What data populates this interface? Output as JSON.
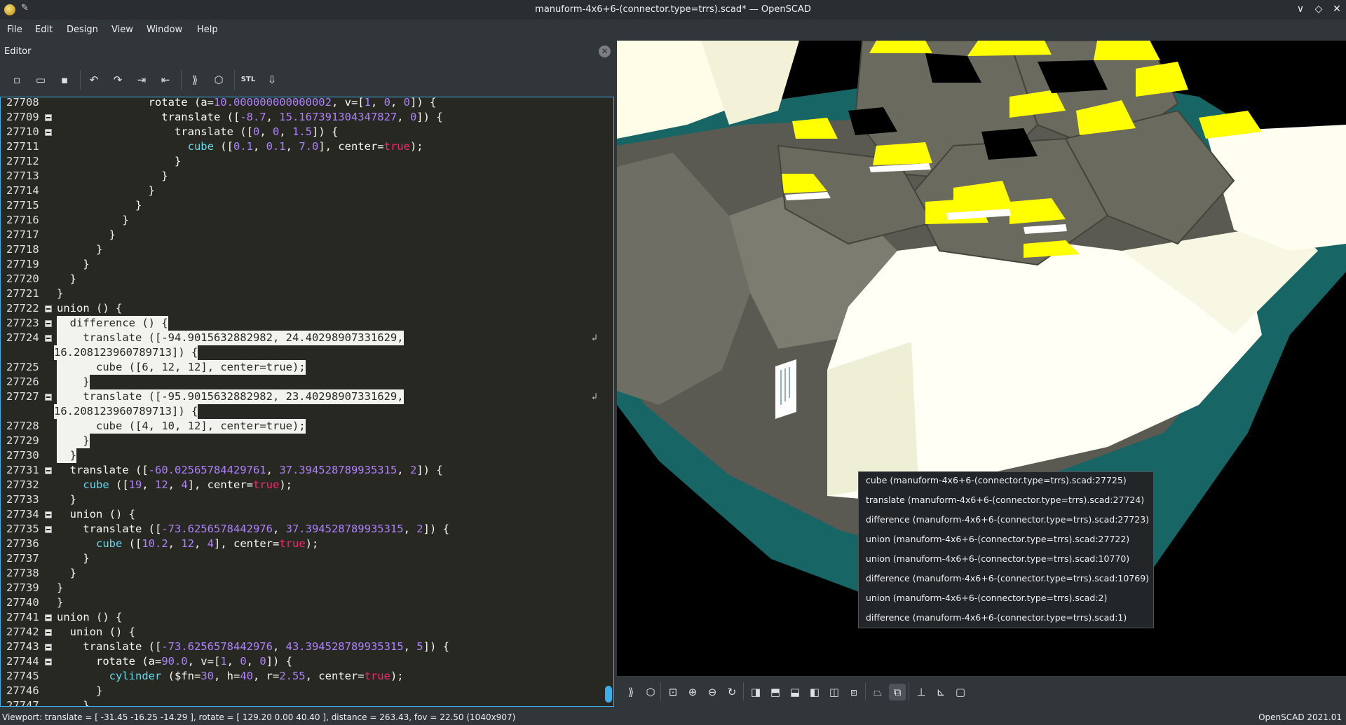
{
  "window": {
    "title": "manuform-4x6+6-(connector.type=trrs).scad* — OpenSCAD",
    "controls": [
      "∨",
      "◇",
      "✕"
    ]
  },
  "menu": [
    "File",
    "Edit",
    "Design",
    "View",
    "Window",
    "Help"
  ],
  "editor": {
    "title": "Editor",
    "close_label": "✕",
    "toolbar": [
      "new-icon",
      "open-icon",
      "save-icon",
      "undo-icon",
      "redo-icon",
      "indent-icon",
      "unindent-icon",
      "preview-icon",
      "render-icon",
      "export-stl-icon",
      "send-to-print-icon"
    ],
    "lines": [
      {
        "num": "27708",
        "fold": false,
        "text": "              rotate (a=10.000000000000002, v=[1, 0, 0]) {"
      },
      {
        "num": "27709",
        "fold": true,
        "text": "                translate ([-8.7, 15.167391304347827, 0]) {"
      },
      {
        "num": "27710",
        "fold": true,
        "text": "                  translate ([0, 0, 1.5]) {"
      },
      {
        "num": "27711",
        "fold": false,
        "text": "                    cube ([0.1, 0.1, 7.0], center=true);"
      },
      {
        "num": "27712",
        "fold": false,
        "text": "                  }"
      },
      {
        "num": "27713",
        "fold": false,
        "text": "                }"
      },
      {
        "num": "27714",
        "fold": false,
        "text": "              }"
      },
      {
        "num": "27715",
        "fold": false,
        "text": "            }"
      },
      {
        "num": "27716",
        "fold": false,
        "text": "          }"
      },
      {
        "num": "27717",
        "fold": false,
        "text": "        }"
      },
      {
        "num": "27718",
        "fold": false,
        "text": "      }"
      },
      {
        "num": "27719",
        "fold": false,
        "text": "    }"
      },
      {
        "num": "27720",
        "fold": false,
        "text": "  }"
      },
      {
        "num": "27721",
        "fold": false,
        "text": "}"
      },
      {
        "num": "27722",
        "fold": true,
        "text": "union () {"
      },
      {
        "num": "27723",
        "fold": true,
        "text": "  difference () {",
        "sel": true
      },
      {
        "num": "27724",
        "fold": true,
        "text": "    translate ([-94.9015632882982, 24.40298907331629,",
        "sel": true,
        "wrap": true
      },
      {
        "num": "",
        "fold": false,
        "text": "16.208123960789713]) {",
        "sel": true,
        "cont": true
      },
      {
        "num": "27725",
        "fold": false,
        "text": "      cube ([6, 12, 12], center=true);",
        "sel": true
      },
      {
        "num": "27726",
        "fold": false,
        "text": "    }",
        "sel": true
      },
      {
        "num": "27727",
        "fold": true,
        "text": "    translate ([-95.9015632882982, 23.40298907331629,",
        "sel": true,
        "wrap": true
      },
      {
        "num": "",
        "fold": false,
        "text": "16.208123960789713]) {",
        "sel": true,
        "cont": true
      },
      {
        "num": "27728",
        "fold": false,
        "text": "      cube ([4, 10, 12], center=true);",
        "sel": true
      },
      {
        "num": "27729",
        "fold": false,
        "text": "    }",
        "sel": true
      },
      {
        "num": "27730",
        "fold": false,
        "text": "  }",
        "sel": true
      },
      {
        "num": "27731",
        "fold": true,
        "text": "  translate ([-60.02565784429761, 37.394528789935315, 2]) {"
      },
      {
        "num": "27732",
        "fold": false,
        "text": "    cube ([19, 12, 4], center=true);"
      },
      {
        "num": "27733",
        "fold": false,
        "text": "  }"
      },
      {
        "num": "27734",
        "fold": true,
        "text": "  union () {"
      },
      {
        "num": "27735",
        "fold": true,
        "text": "    translate ([-73.6256578442976, 37.394528789935315, 2]) {"
      },
      {
        "num": "27736",
        "fold": false,
        "text": "      cube ([10.2, 12, 4], center=true);"
      },
      {
        "num": "27737",
        "fold": false,
        "text": "    }"
      },
      {
        "num": "27738",
        "fold": false,
        "text": "  }"
      },
      {
        "num": "27739",
        "fold": false,
        "text": "}"
      },
      {
        "num": "27740",
        "fold": false,
        "text": "}"
      },
      {
        "num": "27741",
        "fold": true,
        "text": "union () {"
      },
      {
        "num": "27742",
        "fold": true,
        "text": "  union () {"
      },
      {
        "num": "27743",
        "fold": true,
        "text": "    translate ([-73.6256578442976, 43.394528789935315, 5]) {"
      },
      {
        "num": "27744",
        "fold": true,
        "text": "      rotate (a=90.0, v=[1, 0, 0]) {"
      },
      {
        "num": "27745",
        "fold": false,
        "text": "        cylinder ($fn=30, h=40, r=2.55, center=true);"
      },
      {
        "num": "27746",
        "fold": false,
        "text": "      }"
      },
      {
        "num": "27747",
        "fold": false,
        "text": "    }"
      }
    ]
  },
  "context_menu": [
    "cube (manuform-4x6+6-(connector.type=trrs).scad:27725)",
    "translate (manuform-4x6+6-(connector.type=trrs).scad:27724)",
    "difference (manuform-4x6+6-(connector.type=trrs).scad:27723)",
    "union (manuform-4x6+6-(connector.type=trrs).scad:27722)",
    "union (manuform-4x6+6-(connector.type=trrs).scad:10770)",
    "difference (manuform-4x6+6-(connector.type=trrs).scad:10769)",
    "union (manuform-4x6+6-(connector.type=trrs).scad:2)",
    "difference (manuform-4x6+6-(connector.type=trrs).scad:1)"
  ],
  "view_toolbar": [
    "preview-icon",
    "render-icon",
    "view-all-icon",
    "zoom-in-icon",
    "zoom-out-icon",
    "reset-view-icon",
    "view-right-icon",
    "view-top-icon",
    "view-bottom-icon",
    "view-left-icon",
    "view-front-icon",
    "view-back-icon",
    "perspective-icon",
    "orthogonal-icon",
    "show-axes-icon",
    "show-scale-icon",
    "show-edges-icon"
  ],
  "status": {
    "left": "Viewport: translate = [ -31.45 -16.25 -14.29 ], rotate = [ 129.20 0.00 40.40 ], distance = 263.43, fov = 22.50 (1040x907)",
    "right": "OpenSCAD 2021.01"
  },
  "colors": {
    "accent": "#3daee9",
    "editor_bg": "#272822",
    "number": "#ae81ff",
    "keyword": "#66d9ef",
    "boolean": "#f92672",
    "model_yellow": "#ffff00",
    "model_teal": "#1a6b6b"
  }
}
